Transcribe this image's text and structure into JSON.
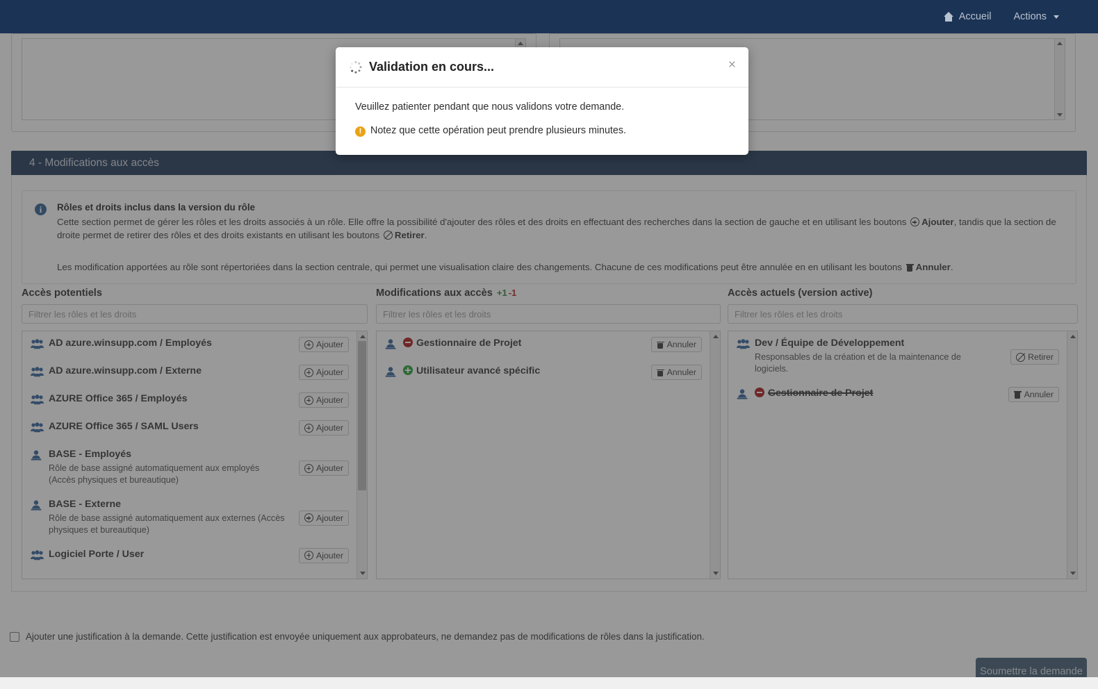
{
  "navbar": {
    "home_label": "Accueil",
    "actions_label": "Actions",
    "home_icon": "home-icon",
    "caret_icon": "chevron-down-icon",
    "background_color": "#1b3355"
  },
  "section": {
    "title": "4 - Modifications aux accès",
    "background_color": "#1b3355"
  },
  "alert": {
    "icon": "info-icon",
    "title": "Rôles et droits inclus dans la version du rôle",
    "paragraph1_part1": "Cette section permet de gérer les rôles et les droits associés à un rôle. Elle offre la possibilité d'ajouter des rôles et des droits en effectuant des recherches dans la section de gauche et en utilisant les boutons ",
    "paragraph1_bold1": "Ajouter",
    "paragraph1_part2": ", tandis que la section de droite permet de retirer des rôles et des droits existants en utilisant les boutons ",
    "paragraph1_bold2": "Retirer",
    "paragraph1_part3": ".",
    "paragraph2_part1": "Les modification apportées au rôle sont répertoriées dans la section centrale, qui permet une visualisation claire des changements. Chacune de ces modifications peut être annulée en en utilisant les boutons ",
    "paragraph2_bold1": "Annuler",
    "paragraph2_part2": "."
  },
  "columns": {
    "potential": {
      "title": "Accès potentiels",
      "filter_placeholder": "Filtrer les rôles et les droits",
      "filter_value": "",
      "items": [
        {
          "icon": "users-group-icon",
          "title": "AD azure.winsupp.com / Employés",
          "desc": "",
          "button": "Ajouter",
          "button_icon": "circle-plus-icon",
          "bold": true
        },
        {
          "icon": "users-group-icon",
          "title": "AD azure.winsupp.com / Externe",
          "desc": "",
          "button": "Ajouter",
          "button_icon": "circle-plus-icon",
          "bold": true
        },
        {
          "icon": "users-group-icon",
          "title": "AZURE Office 365 / Employés",
          "desc": "",
          "button": "Ajouter",
          "button_icon": "circle-plus-icon",
          "bold": true
        },
        {
          "icon": "users-group-icon",
          "title": "AZURE Office 365 / SAML Users",
          "desc": "",
          "button": "Ajouter",
          "button_icon": "circle-plus-icon",
          "bold": true
        },
        {
          "icon": "user-role-icon",
          "title": "BASE - Employés",
          "desc": "Rôle de base assigné automatiquement aux employés (Accès physiques et bureautique)",
          "button": "Ajouter",
          "button_icon": "circle-plus-icon",
          "bold": true
        },
        {
          "icon": "user-role-icon",
          "title": "BASE - Externe",
          "desc": "Rôle de base assigné automatiquement aux externes (Accès physiques et bureautique)",
          "button": "Ajouter",
          "button_icon": "circle-plus-icon",
          "bold": true
        },
        {
          "icon": "users-group-icon",
          "title": "Logiciel Porte / User",
          "desc": "",
          "button": "Ajouter",
          "button_icon": "circle-plus-icon",
          "bold": true
        }
      ]
    },
    "modifications": {
      "title": "Modifications aux accès",
      "badge_added": "+1",
      "badge_removed": "-1",
      "filter_placeholder": "Filtrer les rôles et les droits",
      "filter_value": "",
      "items": [
        {
          "icon": "user-role-icon",
          "status": "removed",
          "status_icon": "circle-minus-icon",
          "title": "Gestionnaire de Projet",
          "desc": "",
          "button": "Annuler",
          "button_icon": "trash-icon",
          "bold": true
        },
        {
          "icon": "user-role-icon",
          "status": "added",
          "status_icon": "circle-plus-icon",
          "title": "Utilisateur avancé spécific",
          "desc": "",
          "button": "Annuler",
          "button_icon": "trash-icon",
          "bold": true
        }
      ]
    },
    "current": {
      "title": "Accès actuels (version active)",
      "filter_placeholder": "Filtrer les rôles et les droits",
      "filter_value": "",
      "items": [
        {
          "icon": "users-group-icon",
          "status": "none",
          "title": "Dev / Équipe de Développement",
          "desc": "Responsables de la création et de la maintenance de logiciels.",
          "button": "Retirer",
          "button_icon": "circle-ban-icon",
          "bold": true,
          "struck": false
        },
        {
          "icon": "user-role-icon",
          "status": "removed",
          "status_icon": "circle-minus-icon",
          "title": "Gestionnaire de Projet",
          "desc": "",
          "button": "Annuler",
          "button_icon": "trash-icon",
          "bold": true,
          "struck": true
        }
      ]
    }
  },
  "footer": {
    "justification_label": "Ajouter une justification à la demande. Cette justification est envoyée uniquement aux approbateurs, ne demandez pas de modifications de rôles dans la justification.",
    "justification_checked": false,
    "submit_label": "Soumettre la demande"
  },
  "modal": {
    "spinner_icon": "spinner-icon",
    "title": "Validation en cours...",
    "close_label": "×",
    "body_text": "Veuillez patienter pendant que nous validons votre demande.",
    "warning_icon": "warning-icon",
    "warning_text": "Notez que cette opération peut prendre plusieurs minutes.",
    "warning_color": "#e8a317"
  }
}
